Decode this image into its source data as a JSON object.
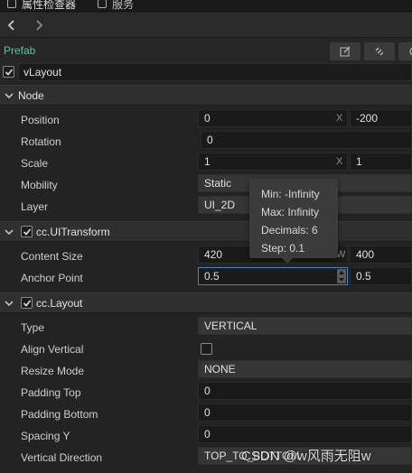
{
  "tabs": [
    {
      "label": "属性检查器",
      "icon": "inspector-icon"
    },
    {
      "label": "服务",
      "icon": "service-icon"
    }
  ],
  "prefab": {
    "label": "Prefab"
  },
  "node_name": {
    "value": "vLayout",
    "enabled": true
  },
  "sections": {
    "node": {
      "title": "Node"
    },
    "uitransform": {
      "title": "cc.UITransform",
      "enabled": true
    },
    "layout": {
      "title": "cc.Layout",
      "enabled": true
    }
  },
  "node": {
    "position": {
      "label": "Position",
      "x": "0",
      "x_axis": "X",
      "y": "-200"
    },
    "rotation": {
      "label": "Rotation",
      "value": "0"
    },
    "scale": {
      "label": "Scale",
      "x": "1",
      "x_axis": "X",
      "y": "1"
    },
    "mobility": {
      "label": "Mobility",
      "value": "Static"
    },
    "layer": {
      "label": "Layer",
      "value": "UI_2D"
    }
  },
  "uitransform": {
    "content_size": {
      "label": "Content Size",
      "w": "420",
      "w_axis": "W",
      "h": "400"
    },
    "anchor_point": {
      "label": "Anchor Point",
      "x": "0.5",
      "y": "0.5"
    }
  },
  "layout": {
    "type": {
      "label": "Type",
      "value": "VERTICAL"
    },
    "align_vertical": {
      "label": "Align Vertical",
      "checked": false
    },
    "resize_mode": {
      "label": "Resize Mode",
      "value": "NONE"
    },
    "padding_top": {
      "label": "Padding Top",
      "value": "0"
    },
    "padding_bottom": {
      "label": "Padding Bottom",
      "value": "0"
    },
    "spacing_y": {
      "label": "Spacing Y",
      "value": "0"
    },
    "vertical_direction": {
      "label": "Vertical Direction",
      "value": "TOP_TO_BOTTOM"
    }
  },
  "tooltip": {
    "min": "Min: -Infinity",
    "max": "Max: Infinity",
    "decimals": "Decimals: 6",
    "step": "Step: 0.1"
  },
  "watermark": "CSDN @w风雨无阻w",
  "colors": {
    "prefab": "#59c89b",
    "focus": "#4b82c2",
    "background": "#232323"
  }
}
